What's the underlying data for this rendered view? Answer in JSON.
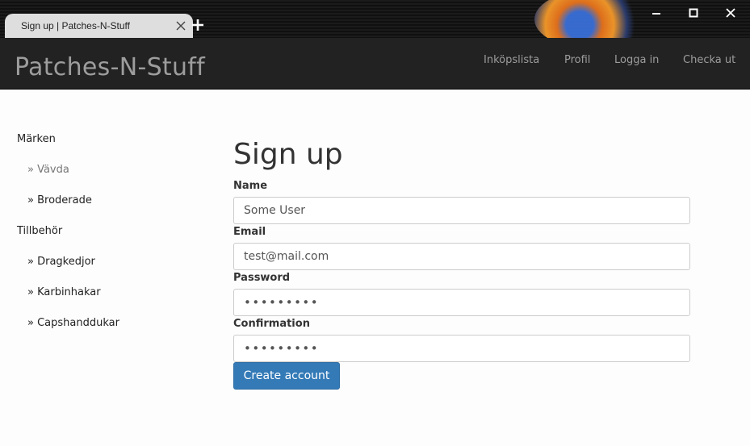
{
  "browser": {
    "tab_title": "Sign up | Patches-N-Stuff",
    "tab_close_icon": "close-icon",
    "new_tab_icon": "plus-icon",
    "window_controls": [
      "minimize-icon",
      "maximize-icon",
      "close-icon"
    ]
  },
  "navbar": {
    "brand": "Patches-N-Stuff",
    "links": [
      "Inköpslista",
      "Profil",
      "Logga in",
      "Checka ut"
    ]
  },
  "sidebar": {
    "groups": [
      {
        "heading": "Märken",
        "items": [
          "» Vävda",
          "» Broderade"
        ]
      },
      {
        "heading": "Tillbehör",
        "items": [
          "» Dragkedjor",
          "» Karbinhakar",
          "» Capshanddukar"
        ]
      }
    ]
  },
  "form": {
    "title": "Sign up",
    "name_label": "Name",
    "name_value": "Some User",
    "email_label": "Email",
    "email_value": "test@mail.com",
    "password_label": "Password",
    "password_value": "•••••••••",
    "confirmation_label": "Confirmation",
    "confirmation_value": "•••••••••",
    "submit_label": "Create account"
  },
  "colors": {
    "navbar_bg": "#222222",
    "nav_text": "#9d9d9d",
    "primary_button": "#337ab7"
  }
}
